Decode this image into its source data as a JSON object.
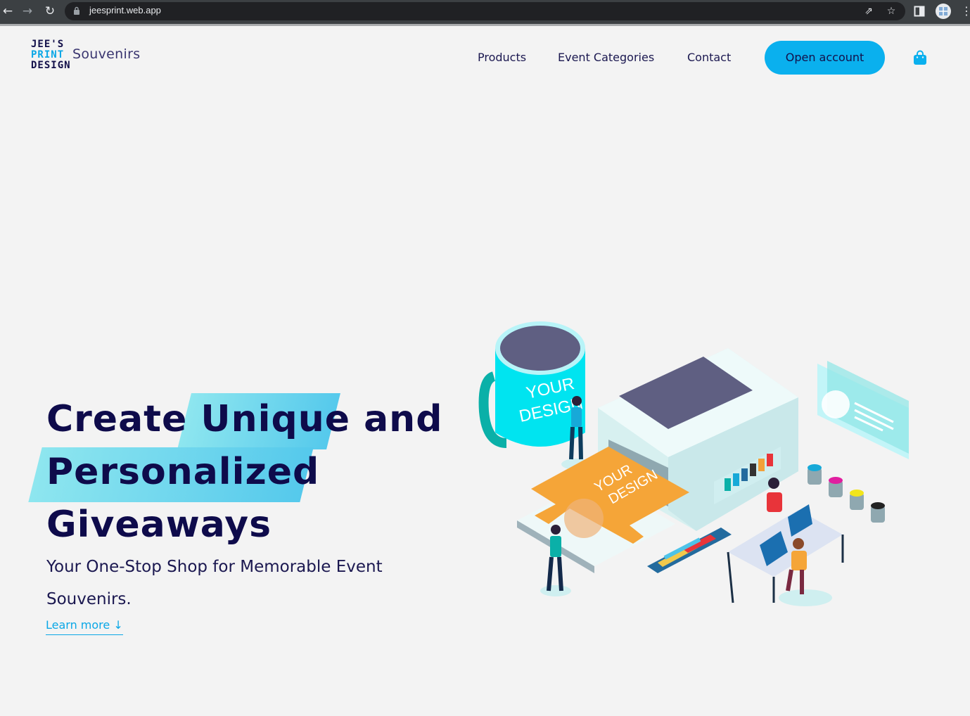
{
  "browser": {
    "url": "jeesprint.web.app"
  },
  "header": {
    "logo_lines": [
      "JEE'S",
      "PRINT",
      "DESIGN"
    ],
    "logo_word": "Souvenirs",
    "nav": [
      "Products",
      "Event Categories",
      "Contact"
    ],
    "cta": "Open account",
    "cart_icon": "shopping-bag-icon"
  },
  "hero": {
    "line1_a": "Create",
    "line1_highlight": "Unique",
    "line1_b": "and",
    "line2_highlight": "Personalized",
    "line3": "Giveaways",
    "subtitle_1": "Your One-Stop Shop for Memorable Event",
    "subtitle_2": "Souvenirs.",
    "learn_more": "Learn more ↓"
  },
  "illustration": {
    "mug_text_1": "YOUR",
    "mug_text_2": "DESIGN",
    "shirt_text_1": "YOUR",
    "shirt_text_2": "DESIGN"
  },
  "colors": {
    "accent": "#0ab0ee",
    "heading": "#0e0b4b",
    "highlight": "#7fe0ee",
    "background": "#f3f3f3"
  }
}
